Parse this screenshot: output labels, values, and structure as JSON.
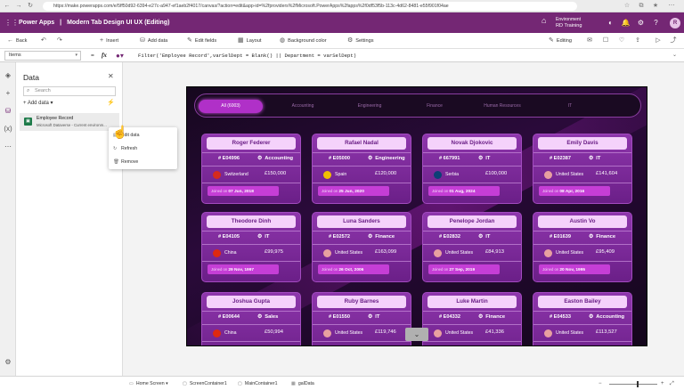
{
  "browser": {
    "url": "https://make.powerapps.com/e/5ff50d92-6394-e27c-a947-ef1aeb2f4017/canvas/?action=edit&app-id=%2fproviders%2fMicrosoft.PowerApps%2fapps%2f0df53f5b-113c-4d62-8481-e55f901f04ae"
  },
  "app": {
    "brand": "Power Apps",
    "separator": "|",
    "title": "Modern Tab Design UI UX (Editing)",
    "env_label": "Environment",
    "env_name": "RD Training",
    "user_initials": "R"
  },
  "toolbar": {
    "back": "Back",
    "insert": "Insert",
    "add_data": "Add data",
    "edit_fields": "Edit fields",
    "layout": "Layout",
    "background_color": "Background color",
    "settings": "Settings",
    "editing": "Editing"
  },
  "formula": {
    "property": "Items",
    "eq": "=",
    "fx": "fx",
    "text": "Filter('Employee Record',varSelDept = Blank() || Department = varSelDept)"
  },
  "panel": {
    "title": "Data",
    "search_placeholder": "Search",
    "add_data": "Add data",
    "source_name": "Employee Record",
    "source_sub": "Microsoft Dataverse - Current environm...",
    "menu": [
      "Edit data",
      "Refresh",
      "Remove"
    ]
  },
  "tabs": [
    "All (6003)",
    "Accounting",
    "Engineering",
    "Finance",
    "Human Resources",
    "IT"
  ],
  "employees": [
    {
      "name": "Roger Federer",
      "id": "# E04996",
      "dept": "Accounting",
      "country": "Switzerland",
      "salary": "£150,000",
      "joined_label": "Joined on",
      "joined": "07 Jun, 2018",
      "flag": "#d52b1e"
    },
    {
      "name": "Rafael Nadal",
      "id": "# E05000",
      "dept": "Engineering",
      "country": "Spain",
      "salary": "£120,000",
      "joined_label": "Joined on",
      "joined": "25 Jun, 2020",
      "flag": "#f1bf00"
    },
    {
      "name": "Novak Djokovic",
      "id": "# 667991",
      "dept": "IT",
      "country": "Serbia",
      "salary": "£100,000",
      "joined_label": "Joined on",
      "joined": "01 Aug, 2024",
      "flag": "#0c4076"
    },
    {
      "name": "Emily Davis",
      "id": "# E02387",
      "dept": "IT",
      "country": "United States",
      "salary": "£141,604",
      "joined_label": "Joined on",
      "joined": "08 Apr, 2016",
      "flag": "#e8a0a0"
    },
    {
      "name": "Theodore Dinh",
      "id": "# E04105",
      "dept": "IT",
      "country": "China",
      "salary": "£99,975",
      "joined_label": "Joined on",
      "joined": "29 Nov, 1997",
      "flag": "#de2910"
    },
    {
      "name": "Luna Sanders",
      "id": "# E02572",
      "dept": "Finance",
      "country": "United States",
      "salary": "£163,099",
      "joined_label": "Joined on",
      "joined": "26 Oct, 2006",
      "flag": "#e8a0a0"
    },
    {
      "name": "Penelope Jordan",
      "id": "# E02832",
      "dept": "IT",
      "country": "United States",
      "salary": "£84,913",
      "joined_label": "Joined on",
      "joined": "27 Sep, 2019",
      "flag": "#e8a0a0"
    },
    {
      "name": "Austin Vo",
      "id": "# E01639",
      "dept": "Finance",
      "country": "United States",
      "salary": "£95,409",
      "joined_label": "Joined on",
      "joined": "20 Nov, 1995",
      "flag": "#e8a0a0"
    },
    {
      "name": "Joshua Gupta",
      "id": "# E00644",
      "dept": "Sales",
      "country": "China",
      "salary": "£50,994",
      "joined_label": "",
      "joined": "",
      "flag": "#de2910"
    },
    {
      "name": "Ruby Barnes",
      "id": "# E01550",
      "dept": "IT",
      "country": "United States",
      "salary": "£119,746",
      "joined_label": "",
      "joined": "",
      "flag": "#e8a0a0"
    },
    {
      "name": "Luke Martin",
      "id": "# E04332",
      "dept": "Finance",
      "country": "United States",
      "salary": "£41,336",
      "joined_label": "",
      "joined": "",
      "flag": "#e8a0a0"
    },
    {
      "name": "Easton Bailey",
      "id": "# E04533",
      "dept": "Accounting",
      "country": "United States",
      "salary": "£113,527",
      "joined_label": "",
      "joined": "",
      "flag": "#e8a0a0"
    }
  ],
  "statusbar": {
    "screen": "Home Screen",
    "container1": "ScreenContainer1",
    "container2": "MainContainer1",
    "gallery": "galData"
  },
  "colors": {
    "accent": "#742774",
    "card": "#8e36ac",
    "tab_active": "#b030c8"
  }
}
